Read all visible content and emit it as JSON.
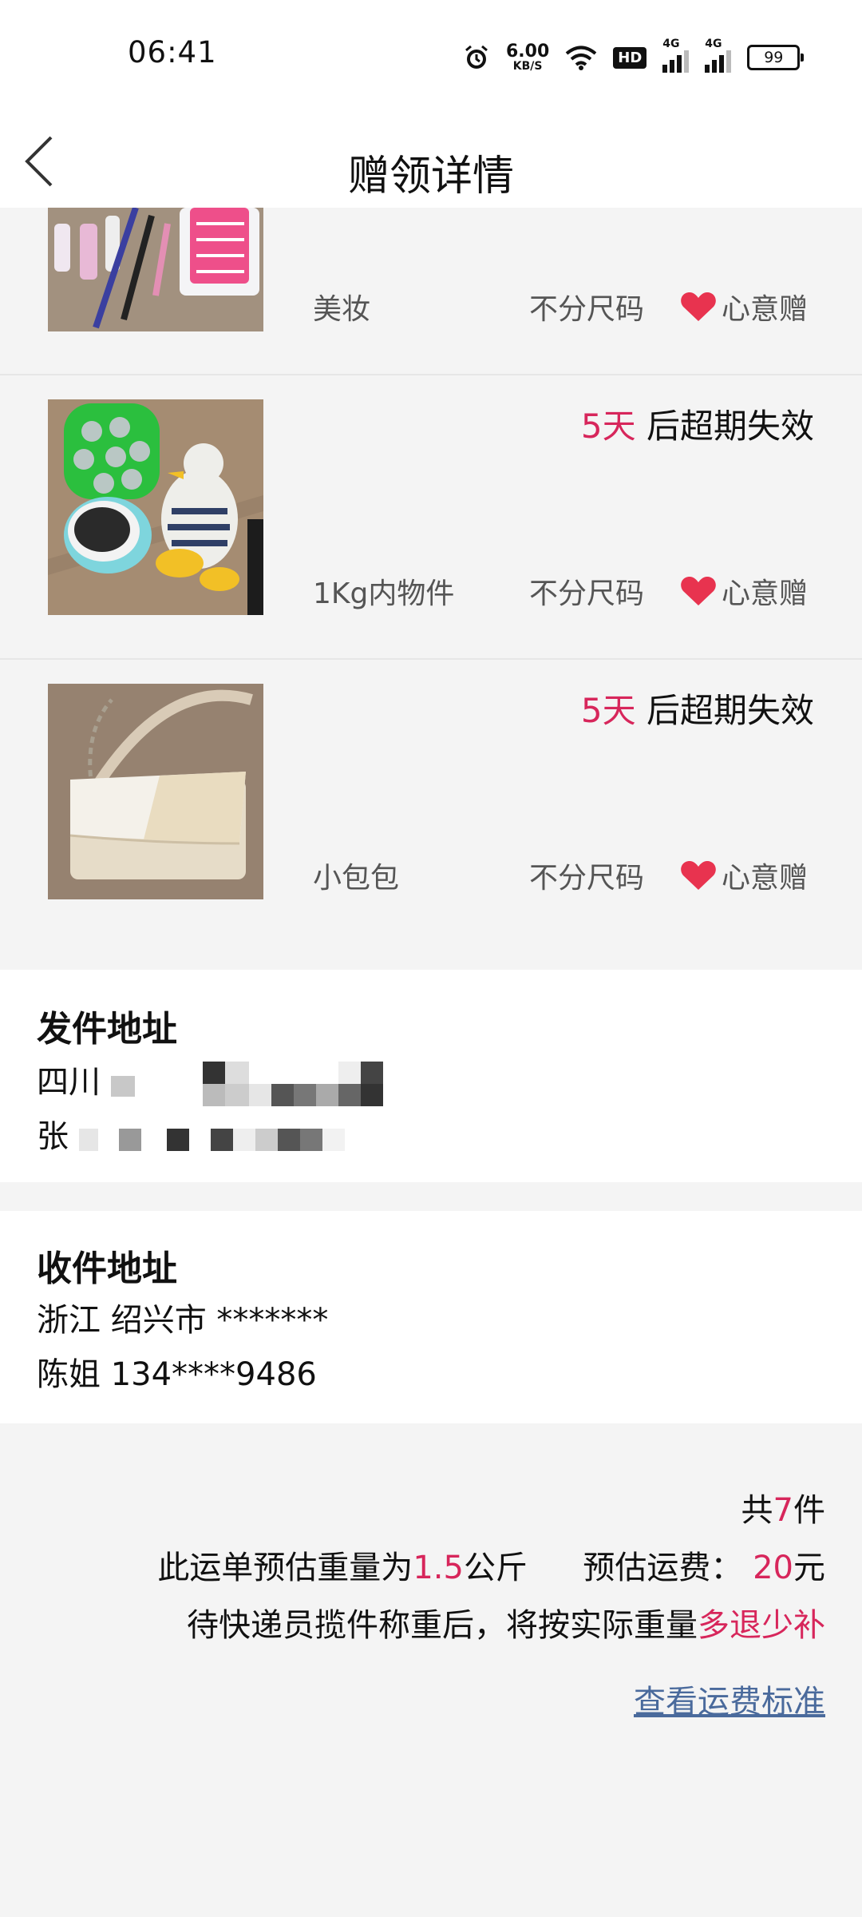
{
  "status_bar": {
    "time": "06:41",
    "net_speed_value": "6.00",
    "net_speed_unit": "KB/S",
    "hd_label": "HD",
    "signal1_label": "4G",
    "signal2_label": "4G",
    "battery": "99",
    "icons": [
      "alarm-icon",
      "wifi-icon",
      "hd-voice-icon",
      "signal-icon",
      "signal-icon",
      "battery-icon"
    ]
  },
  "header": {
    "title": "赠领详情",
    "back_icon": "chevron-left-icon"
  },
  "items": [
    {
      "expire_days": "",
      "expire_suffix": "",
      "category": "美妆",
      "size": "不分尺码",
      "gift_label": "心意赠"
    },
    {
      "expire_days": "5天",
      "expire_suffix": " 后超期失效",
      "category": "1Kg内物件",
      "size": "不分尺码",
      "gift_label": "心意赠"
    },
    {
      "expire_days": "5天",
      "expire_suffix": " 后超期失效",
      "category": "小包包",
      "size": "不分尺码",
      "gift_label": "心意赠"
    }
  ],
  "sender": {
    "title": "发件地址",
    "line1": "四川",
    "line2": "张"
  },
  "receiver": {
    "title": "收件地址",
    "line1": "浙江 绍兴市 *******",
    "line2": "陈姐 134****9486"
  },
  "summary": {
    "total_prefix": "共",
    "total_count": "7",
    "total_suffix": "件",
    "weight_prefix": "此运单预估重量为",
    "weight_value": "1.5",
    "weight_unit": "公斤",
    "fee_prefix": "预估运费：",
    "fee_value": "20",
    "fee_unit": "元",
    "note_prefix": "待快递员揽件称重后，将按实际重量",
    "note_highlight": "多退少补",
    "link_text": "查看运费标准"
  },
  "colors": {
    "accent": "#d7265b",
    "link": "#4a6a9c",
    "background": "#f4f4f4"
  }
}
